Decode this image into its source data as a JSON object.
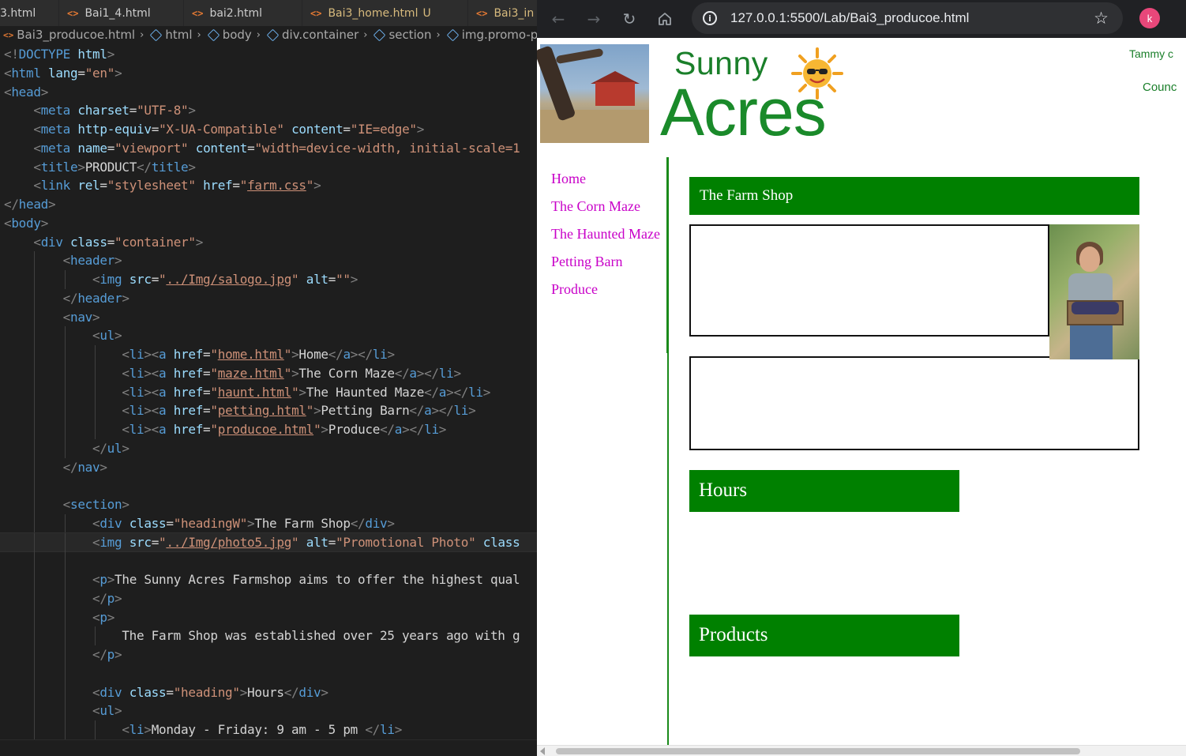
{
  "editor": {
    "tabs": [
      {
        "label": "3.html",
        "icon": "html-file-icon",
        "git": false,
        "status": ""
      },
      {
        "label": "Bai1_4.html",
        "icon": "html-file-icon",
        "git": false,
        "status": ""
      },
      {
        "label": "bai2.html",
        "icon": "html-file-icon",
        "git": false,
        "status": ""
      },
      {
        "label": "Bai3_home.html",
        "icon": "html-file-icon",
        "git": true,
        "status": "U"
      },
      {
        "label": "Bai3_in",
        "icon": "html-file-icon",
        "git": true,
        "status": ""
      }
    ],
    "breadcrumb": {
      "file": "Bai3_producoe.html",
      "items": [
        "html",
        "body",
        "div.container",
        "section",
        "img.promo-p"
      ]
    }
  },
  "browser": {
    "url": "127.0.0.1:5500/Lab/Bai3_producoe.html",
    "profile_initial": "k",
    "page": {
      "logo_sunny": "Sunny",
      "logo_acres": "Acres",
      "tagline_1": "Tammy c",
      "tagline_2": "Counc",
      "nav": [
        {
          "label": "Home"
        },
        {
          "label": "The Corn Maze"
        },
        {
          "label": "The Haunted Maze"
        },
        {
          "label": "Petting Barn"
        },
        {
          "label": "Produce"
        }
      ],
      "heading_shop": "The Farm Shop",
      "heading_hours": "Hours",
      "heading_products": "Products"
    }
  },
  "colors": {
    "accent_green": "#008000",
    "nav_link": "#c800c8",
    "editor_bg": "#1e1e1e",
    "tag": "#569cd6",
    "attribute": "#9cdcfe",
    "string": "#ce9178"
  },
  "code_lines": [
    {
      "active": false,
      "depth": 0,
      "html": "<span class='c-br'>&lt;!</span><span class='c-tag'>DOCTYPE</span> <span class='c-attr'>html</span><span class='c-br'>&gt;</span>"
    },
    {
      "active": false,
      "depth": 0,
      "html": "<span class='c-br'>&lt;</span><span class='c-tag'>html</span> <span class='c-attr'>lang</span>=<span class='c-val'>\"en\"</span><span class='c-br'>&gt;</span>"
    },
    {
      "active": false,
      "depth": 0,
      "html": "<span class='c-br'>&lt;</span><span class='c-tag'>head</span><span class='c-br'>&gt;</span>"
    },
    {
      "active": false,
      "depth": 1,
      "html": "    <span class='c-br'>&lt;</span><span class='c-tag'>meta</span> <span class='c-attr'>charset</span>=<span class='c-val'>\"UTF-8\"</span><span class='c-br'>&gt;</span>"
    },
    {
      "active": false,
      "depth": 1,
      "html": "    <span class='c-br'>&lt;</span><span class='c-tag'>meta</span> <span class='c-attr'>http-equiv</span>=<span class='c-val'>\"X-UA-Compatible\"</span> <span class='c-attr'>content</span>=<span class='c-val'>\"IE=edge\"</span><span class='c-br'>&gt;</span>"
    },
    {
      "active": false,
      "depth": 1,
      "html": "    <span class='c-br'>&lt;</span><span class='c-tag'>meta</span> <span class='c-attr'>name</span>=<span class='c-val'>\"viewport\"</span> <span class='c-attr'>content</span>=<span class='c-val'>\"width=device-width, initial-scale=1</span>"
    },
    {
      "active": false,
      "depth": 1,
      "html": "    <span class='c-br'>&lt;</span><span class='c-tag'>title</span><span class='c-br'>&gt;</span><span class='c-text'>PRODUCT</span><span class='c-br'>&lt;/</span><span class='c-tag'>title</span><span class='c-br'>&gt;</span>"
    },
    {
      "active": false,
      "depth": 1,
      "html": "    <span class='c-br'>&lt;</span><span class='c-tag'>link</span> <span class='c-attr'>rel</span>=<span class='c-val'>\"stylesheet\"</span> <span class='c-attr'>href</span>=<span class='c-val'>\"</span><span class='c-link'>farm.css</span><span class='c-val'>\"</span><span class='c-br'>&gt;</span>"
    },
    {
      "active": false,
      "depth": 0,
      "html": "<span class='c-br'>&lt;/</span><span class='c-tag'>head</span><span class='c-br'>&gt;</span>"
    },
    {
      "active": false,
      "depth": 0,
      "html": "<span class='c-br'>&lt;</span><span class='c-tag'>body</span><span class='c-br'>&gt;</span>"
    },
    {
      "active": false,
      "depth": 1,
      "html": "    <span class='c-br'>&lt;</span><span class='c-tag'>div</span> <span class='c-attr'>class</span>=<span class='c-val'>\"container\"</span><span class='c-br'>&gt;</span>"
    },
    {
      "active": false,
      "depth": 2,
      "html": "        <span class='c-br'>&lt;</span><span class='c-tag'>header</span><span class='c-br'>&gt;</span>"
    },
    {
      "active": false,
      "depth": 3,
      "html": "            <span class='c-br'>&lt;</span><span class='c-tag'>img</span> <span class='c-attr'>src</span>=<span class='c-val'>\"</span><span class='c-link'>../Img/salogo.jpg</span><span class='c-val'>\"</span> <span class='c-attr'>alt</span>=<span class='c-val'>\"\"</span><span class='c-br'>&gt;</span>"
    },
    {
      "active": false,
      "depth": 2,
      "html": "        <span class='c-br'>&lt;/</span><span class='c-tag'>header</span><span class='c-br'>&gt;</span>"
    },
    {
      "active": false,
      "depth": 2,
      "html": "        <span class='c-br'>&lt;</span><span class='c-tag'>nav</span><span class='c-br'>&gt;</span>"
    },
    {
      "active": false,
      "depth": 3,
      "html": "            <span class='c-br'>&lt;</span><span class='c-tag'>ul</span><span class='c-br'>&gt;</span>"
    },
    {
      "active": false,
      "depth": 4,
      "html": "                <span class='c-br'>&lt;</span><span class='c-tag'>li</span><span class='c-br'>&gt;&lt;</span><span class='c-tag'>a</span> <span class='c-attr'>href</span>=<span class='c-val'>\"</span><span class='c-link'>home.html</span><span class='c-val'>\"</span><span class='c-br'>&gt;</span><span class='c-text'>Home</span><span class='c-br'>&lt;/</span><span class='c-tag'>a</span><span class='c-br'>&gt;&lt;/</span><span class='c-tag'>li</span><span class='c-br'>&gt;</span>"
    },
    {
      "active": false,
      "depth": 4,
      "html": "                <span class='c-br'>&lt;</span><span class='c-tag'>li</span><span class='c-br'>&gt;&lt;</span><span class='c-tag'>a</span> <span class='c-attr'>href</span>=<span class='c-val'>\"</span><span class='c-link'>maze.html</span><span class='c-val'>\"</span><span class='c-br'>&gt;</span><span class='c-text'>The Corn Maze</span><span class='c-br'>&lt;/</span><span class='c-tag'>a</span><span class='c-br'>&gt;&lt;/</span><span class='c-tag'>li</span><span class='c-br'>&gt;</span>"
    },
    {
      "active": false,
      "depth": 4,
      "html": "                <span class='c-br'>&lt;</span><span class='c-tag'>li</span><span class='c-br'>&gt;&lt;</span><span class='c-tag'>a</span> <span class='c-attr'>href</span>=<span class='c-val'>\"</span><span class='c-link'>haunt.html</span><span class='c-val'>\"</span><span class='c-br'>&gt;</span><span class='c-text'>The Haunted Maze</span><span class='c-br'>&lt;/</span><span class='c-tag'>a</span><span class='c-br'>&gt;&lt;/</span><span class='c-tag'>li</span><span class='c-br'>&gt;</span>"
    },
    {
      "active": false,
      "depth": 4,
      "html": "                <span class='c-br'>&lt;</span><span class='c-tag'>li</span><span class='c-br'>&gt;&lt;</span><span class='c-tag'>a</span> <span class='c-attr'>href</span>=<span class='c-val'>\"</span><span class='c-link'>petting.html</span><span class='c-val'>\"</span><span class='c-br'>&gt;</span><span class='c-text'>Petting Barn</span><span class='c-br'>&lt;/</span><span class='c-tag'>a</span><span class='c-br'>&gt;&lt;/</span><span class='c-tag'>li</span><span class='c-br'>&gt;</span>"
    },
    {
      "active": false,
      "depth": 4,
      "html": "                <span class='c-br'>&lt;</span><span class='c-tag'>li</span><span class='c-br'>&gt;&lt;</span><span class='c-tag'>a</span> <span class='c-attr'>href</span>=<span class='c-val'>\"</span><span class='c-link'>producoe.html</span><span class='c-val'>\"</span><span class='c-br'>&gt;</span><span class='c-text'>Produce</span><span class='c-br'>&lt;/</span><span class='c-tag'>a</span><span class='c-br'>&gt;&lt;/</span><span class='c-tag'>li</span><span class='c-br'>&gt;</span>"
    },
    {
      "active": false,
      "depth": 3,
      "html": "            <span class='c-br'>&lt;/</span><span class='c-tag'>ul</span><span class='c-br'>&gt;</span>"
    },
    {
      "active": false,
      "depth": 2,
      "html": "        <span class='c-br'>&lt;/</span><span class='c-tag'>nav</span><span class='c-br'>&gt;</span>"
    },
    {
      "active": false,
      "depth": 2,
      "html": ""
    },
    {
      "active": false,
      "depth": 2,
      "html": "        <span class='c-br'>&lt;</span><span class='c-tag'>section</span><span class='c-br'>&gt;</span>"
    },
    {
      "active": false,
      "depth": 3,
      "html": "            <span class='c-br'>&lt;</span><span class='c-tag'>div</span> <span class='c-attr'>class</span>=<span class='c-val'>\"headingW\"</span><span class='c-br'>&gt;</span><span class='c-text'>The Farm Shop</span><span class='c-br'>&lt;/</span><span class='c-tag'>div</span><span class='c-br'>&gt;</span>"
    },
    {
      "active": true,
      "depth": 3,
      "html": "            <span class='c-br'>&lt;</span><span class='c-tag'>img</span> <span class='c-attr'>src</span>=<span class='c-val'>\"</span><span class='c-link'>../Img/photo5.jpg</span><span class='c-val'>\"</span> <span class='c-attr'>alt</span>=<span class='c-val'>\"Promotional Photo\"</span> <span class='c-attr'>class</span>"
    },
    {
      "active": false,
      "depth": 3,
      "html": ""
    },
    {
      "active": false,
      "depth": 3,
      "html": "            <span class='c-br'>&lt;</span><span class='c-tag'>p</span><span class='c-br'>&gt;</span><span class='c-text'>The Sunny Acres Farmshop aims to offer the highest qual</span>"
    },
    {
      "active": false,
      "depth": 3,
      "html": "            <span class='c-br'>&lt;/</span><span class='c-tag'>p</span><span class='c-br'>&gt;</span>"
    },
    {
      "active": false,
      "depth": 3,
      "html": "            <span class='c-br'>&lt;</span><span class='c-tag'>p</span><span class='c-br'>&gt;</span>"
    },
    {
      "active": false,
      "depth": 4,
      "html": "                <span class='c-text'>The Farm Shop was established over 25 years ago with g</span>"
    },
    {
      "active": false,
      "depth": 3,
      "html": "            <span class='c-br'>&lt;/</span><span class='c-tag'>p</span><span class='c-br'>&gt;</span>"
    },
    {
      "active": false,
      "depth": 3,
      "html": ""
    },
    {
      "active": false,
      "depth": 3,
      "html": "            <span class='c-br'>&lt;</span><span class='c-tag'>div</span> <span class='c-attr'>class</span>=<span class='c-val'>\"heading\"</span><span class='c-br'>&gt;</span><span class='c-text'>Hours</span><span class='c-br'>&lt;/</span><span class='c-tag'>div</span><span class='c-br'>&gt;</span>"
    },
    {
      "active": false,
      "depth": 3,
      "html": "            <span class='c-br'>&lt;</span><span class='c-tag'>ul</span><span class='c-br'>&gt;</span>"
    },
    {
      "active": false,
      "depth": 4,
      "html": "                <span class='c-br'>&lt;</span><span class='c-tag'>li</span><span class='c-br'>&gt;</span><span class='c-text'>Monday - Friday: 9 am - 5 pm </span><span class='c-br'>&lt;/</span><span class='c-tag'>li</span><span class='c-br'>&gt;</span>"
    }
  ]
}
